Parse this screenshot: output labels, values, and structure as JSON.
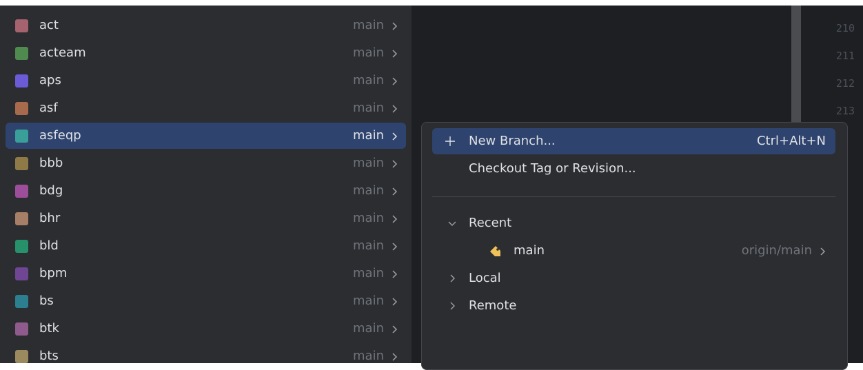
{
  "repositories": [
    {
      "name": "act",
      "branch": "main",
      "color": "#a5626f"
    },
    {
      "name": "acteam",
      "branch": "main",
      "color": "#4f8a4f"
    },
    {
      "name": "aps",
      "branch": "main",
      "color": "#6b5bd6"
    },
    {
      "name": "asf",
      "branch": "main",
      "color": "#a86a4d"
    },
    {
      "name": "asfeqp",
      "branch": "main",
      "color": "#3a9f98",
      "selected": true
    },
    {
      "name": "bbb",
      "branch": "main",
      "color": "#8f7a47"
    },
    {
      "name": "bdg",
      "branch": "main",
      "color": "#9d4e9a"
    },
    {
      "name": "bhr",
      "branch": "main",
      "color": "#a77e66"
    },
    {
      "name": "bld",
      "branch": "main",
      "color": "#26916a"
    },
    {
      "name": "bpm",
      "branch": "main",
      "color": "#6e4693"
    },
    {
      "name": "bs",
      "branch": "main",
      "color": "#2b7f8f"
    },
    {
      "name": "btk",
      "branch": "main",
      "color": "#8f5a8c"
    },
    {
      "name": "bts",
      "branch": "main",
      "color": "#9c8a5f"
    }
  ],
  "editor": {
    "line_numbers": [
      "210",
      "211",
      "212",
      "213"
    ]
  },
  "branch_popup": {
    "new_branch": {
      "label": "New Branch...",
      "shortcut": "Ctrl+Alt+N",
      "icon": "plus-icon"
    },
    "checkout": {
      "label": "Checkout Tag or Revision..."
    },
    "recent": {
      "label": "Recent",
      "expanded": true,
      "icon": "chevron-down-icon"
    },
    "recent_branch": {
      "name": "main",
      "tracking": "origin/main",
      "icon": "tag-icon",
      "icon_color": "#f0c05a"
    },
    "local": {
      "label": "Local",
      "expanded": false,
      "icon": "chevron-right-icon"
    },
    "remote": {
      "label": "Remote",
      "expanded": false,
      "icon": "chevron-right-icon"
    }
  },
  "colors": {
    "panel_bg": "#2b2d30",
    "selection_bg": "#2e436e",
    "text": "#dfe1e5",
    "muted_text": "#6f737a",
    "editor_bg": "#1e1f22"
  }
}
